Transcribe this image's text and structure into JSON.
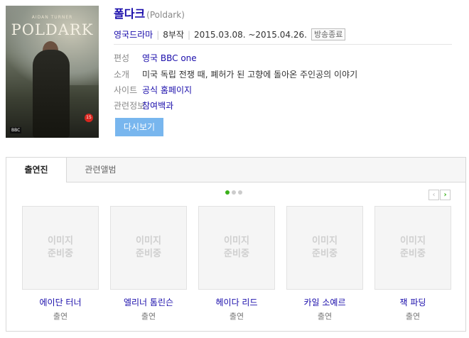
{
  "drama": {
    "title": "폴다크",
    "original_title": "(Poldark)",
    "genre": "영국드라마",
    "episodes": "8부작",
    "period": "2015.03.08. ~2015.04.26.",
    "status_badge": "방송종료",
    "poster": {
      "actor_line": "AIDAN TURNER",
      "logo": "POLDARK",
      "broadcaster": "BBC",
      "rating": "15"
    }
  },
  "info": [
    {
      "label": "편성",
      "value": "영국 BBC one",
      "link": true
    },
    {
      "label": "소개",
      "value": "미국 독립 전쟁 때, 폐허가 된 고향에 돌아온 주인공의 이야기",
      "link": false
    },
    {
      "label": "사이트",
      "value": "공식 홈페이지",
      "link": true
    },
    {
      "label": "관련정보",
      "value": "참여백과",
      "link": true
    }
  ],
  "watch_button": "다시보기",
  "tabs": [
    {
      "label": "출연진",
      "active": true
    },
    {
      "label": "관련앨범",
      "active": false
    }
  ],
  "carousel": {
    "pages": 3,
    "current": 1,
    "prev_icon": "chevron-left-icon",
    "next_icon": "chevron-right-icon"
  },
  "image_placeholder": [
    "이미지",
    "준비중"
  ],
  "cast": [
    {
      "name": "에이단 터너",
      "role": "출연"
    },
    {
      "name": "엘리너 톰린슨",
      "role": "출연"
    },
    {
      "name": "헤이다 리드",
      "role": "출연"
    },
    {
      "name": "카일 소예르",
      "role": "출연"
    },
    {
      "name": "잭 파딩",
      "role": "출연"
    }
  ],
  "colors": {
    "link": "#1a0dab",
    "accent_green": "#3ab01a",
    "button": "#78b6ee"
  }
}
